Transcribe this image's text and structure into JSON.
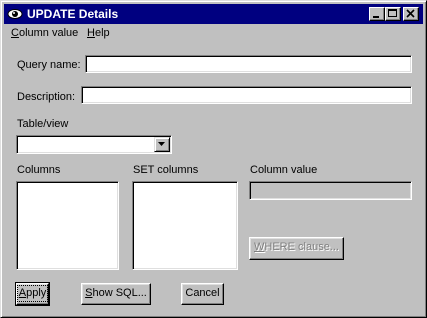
{
  "window": {
    "title": "UPDATE Details"
  },
  "menu": {
    "column_value": "Column value",
    "column_value_mnemonic": "C",
    "column_value_rest": "olumn value",
    "help": "Help",
    "help_mnemonic": "H",
    "help_rest": "elp"
  },
  "form": {
    "query_name_label": "Query name:",
    "query_name_value": "",
    "description_label": "Description:",
    "description_value": "",
    "table_view_label": "Table/view",
    "table_view_value": "",
    "columns_label": "Columns",
    "set_columns_label": "SET columns",
    "column_value_label": "Column value",
    "column_value_value": ""
  },
  "buttons": {
    "where_clause_mnemonic": "W",
    "where_clause_rest": "HERE clause...",
    "apply_mnemonic": "A",
    "apply_rest": "pply",
    "show_sql_mnemonic": "S",
    "show_sql_rest": "how SQL...",
    "cancel": "Cancel"
  },
  "colors": {
    "titlebar": "#000080",
    "face": "#c0c0c0"
  },
  "icons": {
    "app": "eye-icon",
    "minimize": "minimize-icon",
    "maximize": "maximize-icon",
    "close": "close-icon",
    "dropdown": "chevron-down-icon"
  }
}
